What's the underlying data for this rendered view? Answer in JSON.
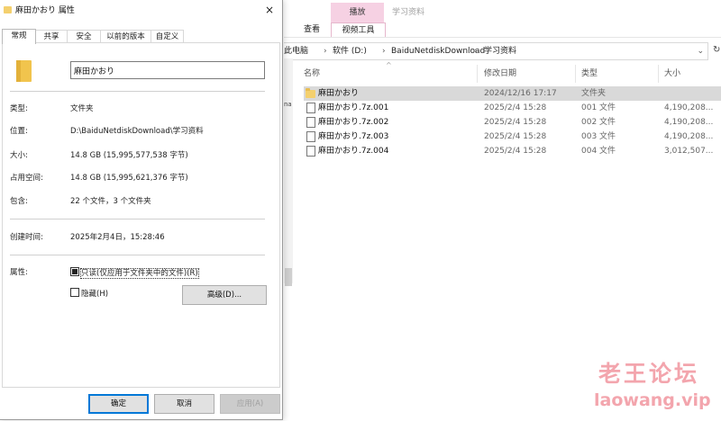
{
  "explorer": {
    "ribbon": {
      "context_tab": "播放",
      "context_group": "学习资料",
      "tabs": [
        "查看",
        "视频工具"
      ]
    },
    "breadcrumb": [
      "此电脑",
      "软件 (D:)",
      "BaiduNetdiskDownload",
      "学习资料"
    ],
    "left_pane_text": "na",
    "columns": {
      "name": "名称",
      "date": "修改日期",
      "type": "类型",
      "size": "大小"
    },
    "files": [
      {
        "name": "麻田かおり",
        "date": "2024/12/16 17:17",
        "type": "文件夹",
        "size": "",
        "icon": "folder-icon",
        "selected": true
      },
      {
        "name": "麻田かおり.7z.001",
        "date": "2025/2/4 15:28",
        "type": "001 文件",
        "size": "4,190,208...",
        "icon": "file-icon",
        "selected": false
      },
      {
        "name": "麻田かおり.7z.002",
        "date": "2025/2/4 15:28",
        "type": "002 文件",
        "size": "4,190,208...",
        "icon": "file-icon",
        "selected": false
      },
      {
        "name": "麻田かおり.7z.003",
        "date": "2025/2/4 15:28",
        "type": "003 文件",
        "size": "4,190,208...",
        "icon": "file-icon",
        "selected": false
      },
      {
        "name": "麻田かおり.7z.004",
        "date": "2025/2/4 15:28",
        "type": "004 文件",
        "size": "3,012,507...",
        "icon": "file-icon",
        "selected": false
      }
    ]
  },
  "dialog": {
    "title": "麻田かおり 属性",
    "close": "×",
    "tabs": [
      "常规",
      "共享",
      "安全",
      "以前的版本",
      "自定义"
    ],
    "active_tab": "常规",
    "folder_name": "麻田かおり",
    "props": {
      "type_label": "类型:",
      "type_value": "文件夹",
      "location_label": "位置:",
      "location_value": "D:\\BaiduNetdiskDownload\\学习资料",
      "size_label": "大小:",
      "size_value": "14.8 GB (15,995,577,538 字节)",
      "disk_label": "占用空间:",
      "disk_value": "14.8 GB (15,995,621,376 字节)",
      "contains_label": "包含:",
      "contains_value": "22 个文件，3 个文件夹",
      "created_label": "创建时间:",
      "created_value": "2025年2月4日，15:28:46",
      "attr_label": "属性:"
    },
    "attributes": {
      "readonly": "只读(仅应用于文件夹中的文件)(R)",
      "readonly_state": "indeterminate",
      "hidden": "隐藏(H)",
      "hidden_state": "unchecked",
      "advanced": "高级(D)..."
    },
    "buttons": {
      "ok": "确定",
      "cancel": "取消",
      "apply": "应用(A)"
    }
  },
  "watermark": {
    "cn": "老王论坛",
    "en": "laowang.vip"
  },
  "colors": {
    "accent": "#0078d7",
    "folder": "#f4d06e",
    "context_tab_bg": "#f6d1e3",
    "selected_row": "#d9d9d9",
    "watermark": "#f3a5ad"
  }
}
